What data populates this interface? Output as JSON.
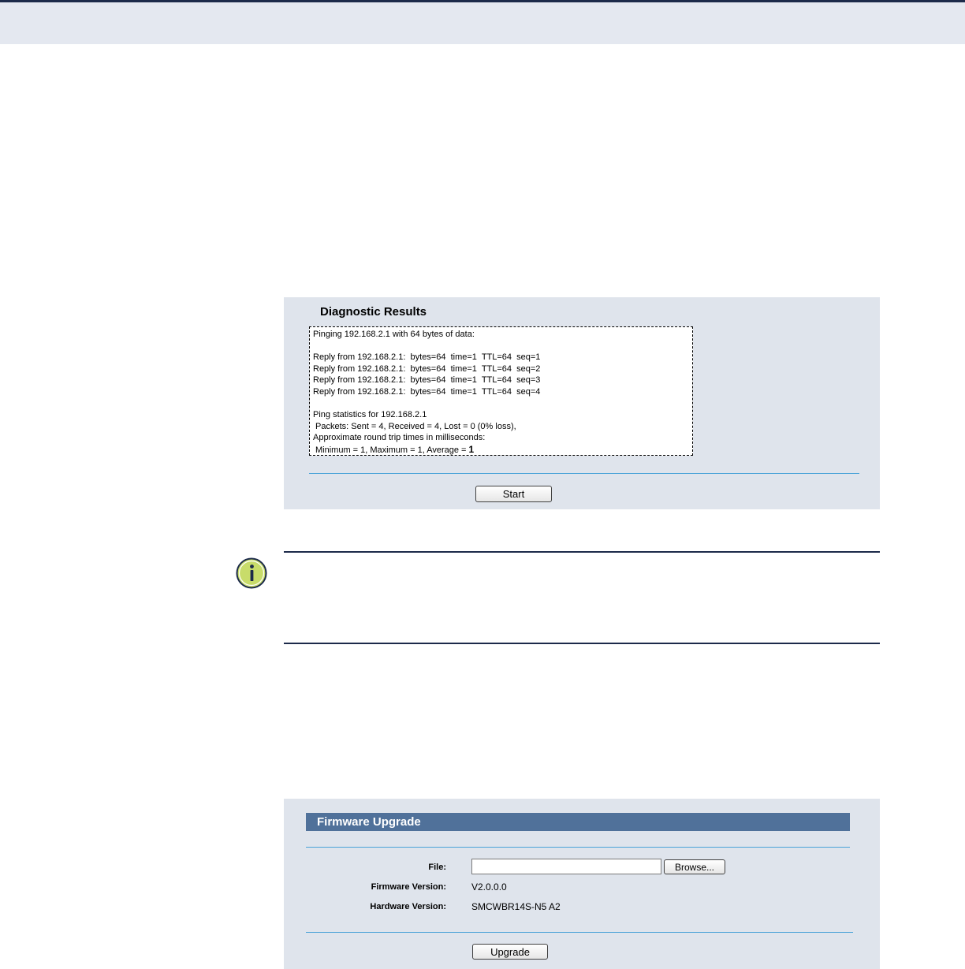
{
  "diagnostic": {
    "title": "Diagnostic Results",
    "lines": [
      "Pinging 192.168.2.1 with 64 bytes of data:",
      "",
      "Reply from 192.168.2.1:  bytes=64  time=1  TTL=64  seq=1",
      "Reply from 192.168.2.1:  bytes=64  time=1  TTL=64  seq=2",
      "Reply from 192.168.2.1:  bytes=64  time=1  TTL=64  seq=3",
      "Reply from 192.168.2.1:  bytes=64  time=1  TTL=64  seq=4",
      "",
      "Ping statistics for 192.168.2.1",
      "Packets: Sent = 4, Received = 4, Lost = 0 (0% loss),",
      "Approximate round trip times in milliseconds:",
      "Minimum = 1, Maximum = 1, Average = "
    ],
    "average_value": "1",
    "start_label": "Start"
  },
  "note": {
    "icon": "info-icon"
  },
  "firmware": {
    "title": "Firmware Upgrade",
    "file_label": "File:",
    "file_value": "",
    "browse_label": "Browse...",
    "firmware_version_label": "Firmware Version:",
    "firmware_version_value": "V2.0.0.0",
    "hardware_version_label": "Hardware Version:",
    "hardware_version_value": "SMCWBR14S-N5 A2",
    "upgrade_label": "Upgrade"
  },
  "colors": {
    "panel_bg": "#dfe4ec",
    "header_bar": "#50719a",
    "divider": "#4aa3d8",
    "rule": "#1c2a4a",
    "icon_green": "#c8dc6a"
  }
}
